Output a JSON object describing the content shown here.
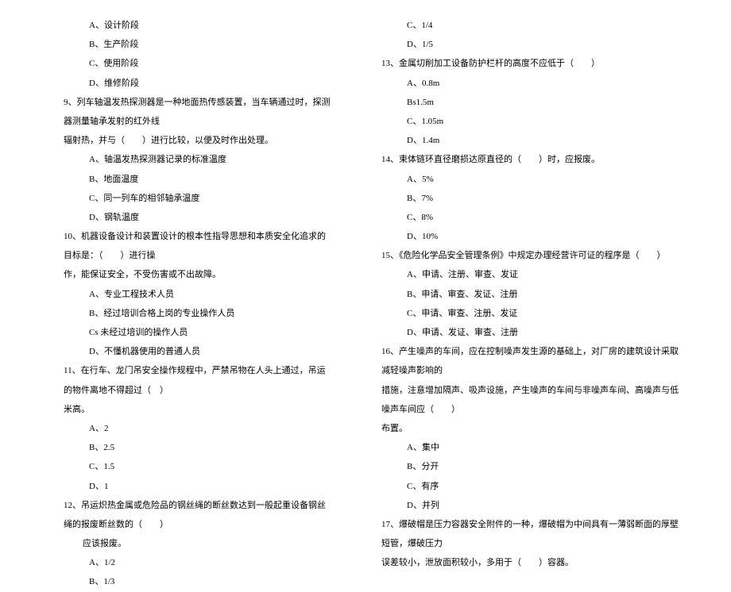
{
  "left": {
    "q8": {
      "a": "A、设计阶段",
      "b": "B、生产阶段",
      "c": "C、使用阶段",
      "d": "D、维修阶段"
    },
    "q9": {
      "text1": "9、列车轴温发热探测器是一种地面热传感装置，当车辆通过时，探测器测量轴承发射的红外线",
      "text2": "辐射热，并与（　　）进行比较，以便及时作出处理。",
      "a": "A、轴温发热探测器记录的标准温度",
      "b": "B、地面温度",
      "c": "C、同一列车的相邻轴承温度",
      "d": "D、钢轨温度"
    },
    "q10": {
      "text1": "10、机器设备设计和装置设计的根本性指导思想和本质安全化追求的目标是：（　　）进行操",
      "text2": "作，能保证安全，不受伤害或不出故障。",
      "a": "A、专业工程技术人员",
      "b": "B、经过培训合格上岗的专业操作人员",
      "c": "Cs 未经过培训的操作人员",
      "d": "D、不懂机器使用的普通人员"
    },
    "q11": {
      "text1": "11、在行车、龙门吊安全操作规程中，严禁吊物在人头上通过，吊运的物件离地不得超过（　）",
      "text2": "米高。",
      "a": "A、2",
      "b": "B、2.5",
      "c": "C、1.5",
      "d": "D、1"
    },
    "q12": {
      "text1": "12、吊运炽热金属或危险品的钢丝绳的断丝数达到一般起重设备钢丝绳的报废断丝数的（　　）",
      "text2": "应该报废。",
      "a": "A、1/2",
      "b": "B、1/3"
    }
  },
  "right": {
    "q12c": {
      "c": "C、1/4",
      "d": "D、1/5"
    },
    "q13": {
      "text": "13、金属切削加工设备防护栏杆的高度不应低于（　　）",
      "a": "A、0.8m",
      "b": "Bs1.5m",
      "c": "C、1.05m",
      "d": "D、1.4m"
    },
    "q14": {
      "text": "14、束体链环直径磨损达原直径的（　　）时，应报废。",
      "a": "A、5%",
      "b": "B、7%",
      "c": "C、8%",
      "d": "D、10%"
    },
    "q15": {
      "text": "15、《危险化学品安全管理条例》中规定办理经营许可证的程序是（　　）",
      "a": "A、申请、注册、审查、发证",
      "b": "B、申请、审查、发证、注册",
      "c": "C、申请、审查、注册、发证",
      "d": "D、申请、发证、审查、注册"
    },
    "q16": {
      "text1": "16、产生噪声的车间，应在控制噪声发生源的基础上，对厂房的建筑设计采取减轻噪声影响的",
      "text2": "措施，注意增加隔声、吸声设施，产生噪声的车间与非噪声车间、高噪声与低噪声车间应（　　）",
      "text3": "布置。",
      "a": "A、集中",
      "b": "B、分开",
      "c": "C、有序",
      "d": "D、并列"
    },
    "q17": {
      "text1": "17、爆破帽是压力容器安全附件的一种，爆破帽为中间具有一薄弱断面的厚壁短管，爆破压力",
      "text2": "误差较小，泄放面积较小，多用于（　　）容器。"
    }
  }
}
